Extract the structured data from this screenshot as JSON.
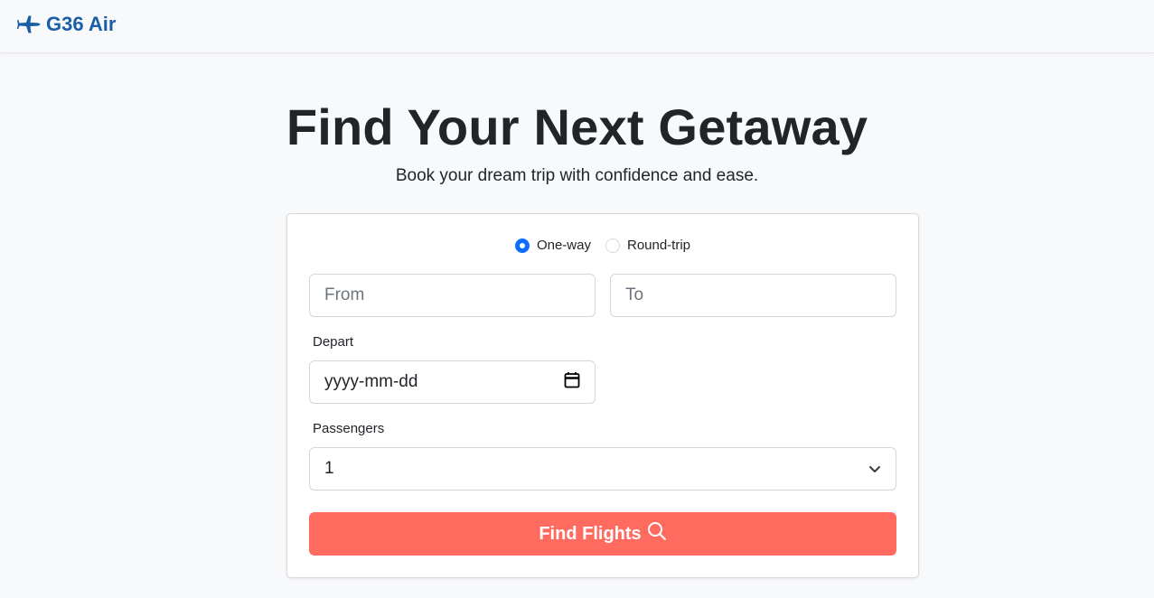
{
  "navbar": {
    "brand_icon": "airplane-icon",
    "brand_text": "G36 Air",
    "brand_color": "#1a5ea8"
  },
  "hero": {
    "title": "Find Your Next Getaway",
    "subtitle": "Book your dream trip with confidence and ease."
  },
  "search": {
    "trip_types": [
      {
        "label": "One-way",
        "checked": true
      },
      {
        "label": "Round-trip",
        "checked": false
      }
    ],
    "from": {
      "placeholder": "From",
      "value": ""
    },
    "to": {
      "placeholder": "To",
      "value": ""
    },
    "depart": {
      "label": "Depart",
      "value": "yyyy-mm-dd",
      "icon": "calendar-icon"
    },
    "passengers": {
      "label": "Passengers",
      "selected": "1",
      "icon": "chevron-down-icon"
    },
    "submit": {
      "label": "Find Flights",
      "icon": "search-icon",
      "color": "#ff6b5f"
    }
  },
  "colors": {
    "accent": "#0d6efd",
    "background": "#f8f9fa"
  }
}
